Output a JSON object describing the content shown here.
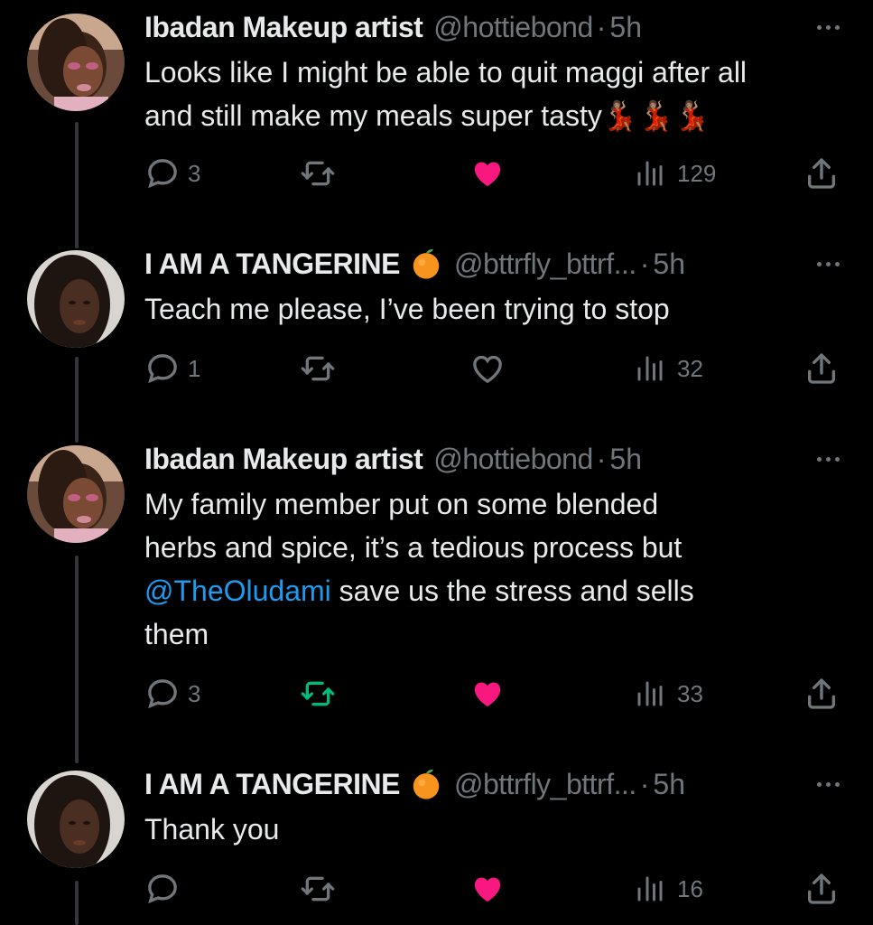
{
  "tweets": [
    {
      "name": "Ibadan Makeup artist",
      "handle": "@hottiebond",
      "time": "5h",
      "badge": "",
      "text_parts": [
        "Looks like I might be able to quit maggi after all",
        "and still make my meals super tasty💃🏽💃🏽💃🏽"
      ],
      "replies": "3",
      "retweets": "",
      "likes": "",
      "views": "129",
      "liked": true,
      "retweeted": false
    },
    {
      "name": "I AM A TANGERINE",
      "handle": "@bttrfly_bttrf...",
      "time": "5h",
      "badge": "🍊",
      "text_parts": [
        "Teach me please, I’ve been trying to stop"
      ],
      "replies": "1",
      "retweets": "",
      "likes": "",
      "views": "32",
      "liked": false,
      "retweeted": false
    },
    {
      "name": "Ibadan Makeup artist",
      "handle": "@hottiebond",
      "time": "5h",
      "badge": "",
      "text_parts": [
        "My family member put on some blended",
        "herbs and spice, it’s a tedious process  but"
      ],
      "mention": "@TheOludami",
      "text_after_mention": " save us the stress and sells",
      "text_last": "them",
      "replies": "3",
      "retweets": "",
      "likes": "",
      "views": "33",
      "liked": true,
      "retweeted": true
    },
    {
      "name": "I AM A TANGERINE",
      "handle": "@bttrfly_bttrf...",
      "time": "5h",
      "badge": "🍊",
      "text_parts": [
        "Thank you"
      ],
      "replies": "",
      "retweets": "",
      "likes": "",
      "views": "16",
      "liked": true,
      "retweeted": false
    }
  ],
  "separator": "·",
  "colors": {
    "background": "#000000",
    "text": "#e7e9ea",
    "secondary": "#71767b",
    "like": "#f91880",
    "retweet": "#00ba7c",
    "mention": "#1d9bf0",
    "thread_line": "#333639"
  },
  "icons": {
    "reply": "reply-icon",
    "retweet": "retweet-icon",
    "like": "heart-icon",
    "views": "views-icon",
    "share": "share-icon",
    "more": "more-icon"
  }
}
